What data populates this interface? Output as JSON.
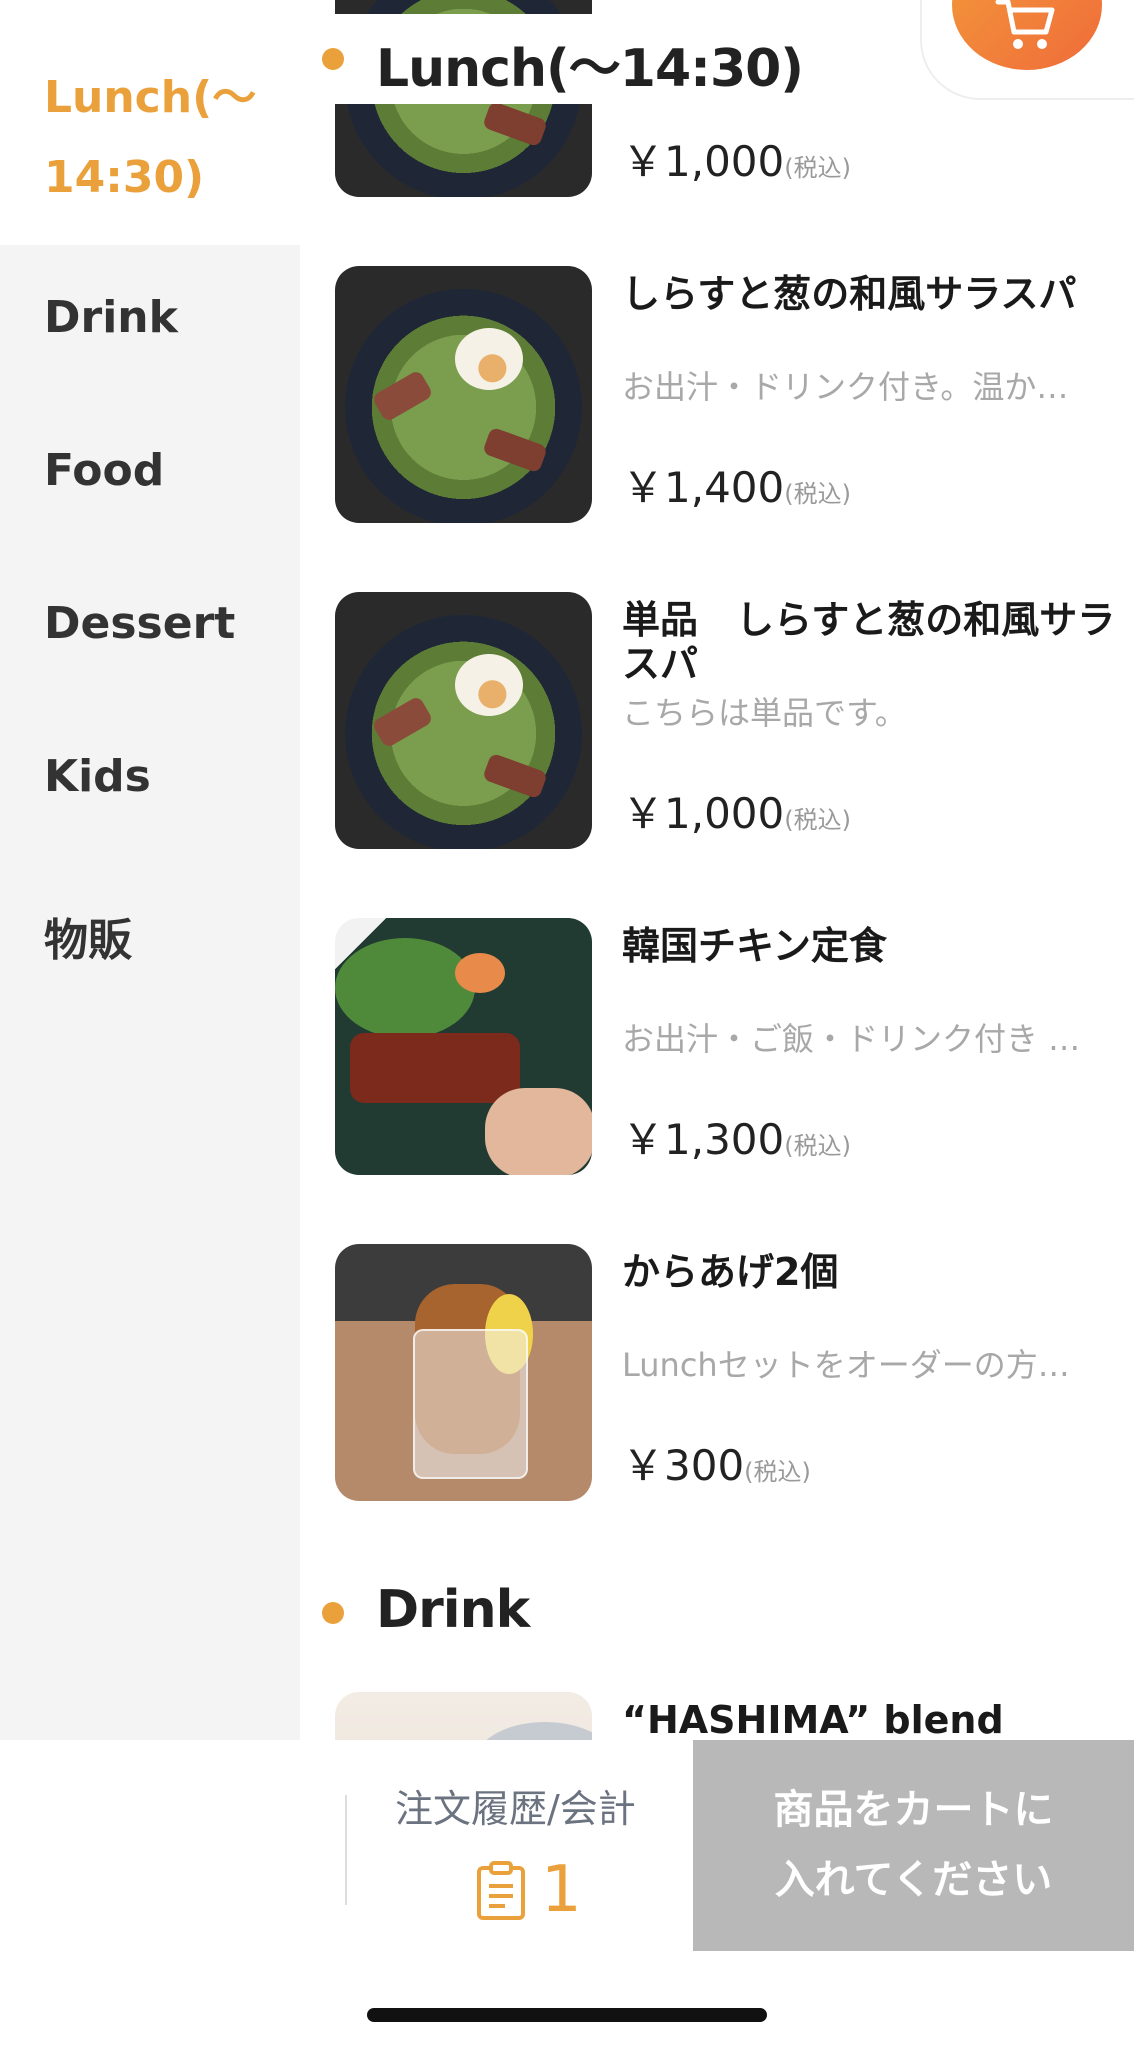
{
  "sidebar": {
    "active": "Lunch(〜14:30)",
    "items": [
      "Drink",
      "Food",
      "Dessert",
      "Kids",
      "物販"
    ]
  },
  "sections": [
    {
      "title": "Lunch(〜14:30)"
    },
    {
      "title": "Drink"
    }
  ],
  "menu_items": [
    {
      "name": "",
      "description": "",
      "price": "￥1,000",
      "tax": "(税込)"
    },
    {
      "name": "しらすと葱の和風サラスパ",
      "description": "お出汁・ドリンク付き。温か…",
      "price": "￥1,400",
      "tax": "(税込)"
    },
    {
      "name": "単品　しらすと葱の和風サラスパ",
      "description": "こちらは単品です。",
      "price": "￥1,000",
      "tax": "(税込)"
    },
    {
      "name": "韓国チキン定食",
      "description": "お出汁・ご飯・ドリンク付き …",
      "price": "￥1,300",
      "tax": "(税込)"
    },
    {
      "name": "からあげ2個",
      "description": "Lunchセットをオーダーの方…",
      "price": "￥300",
      "tax": "(税込)"
    },
    {
      "name": "“HASHIMA” blend"
    }
  ],
  "bottom_bar": {
    "history_label": "注文履歴/会計",
    "history_count": "1",
    "cta_line1": "商品をカートに",
    "cta_line2": "入れてください"
  },
  "icons": {
    "cart": "cart-icon",
    "clipboard": "clipboard-icon",
    "section_dot": "bullet-dot-icon"
  },
  "colors": {
    "accent": "#eba13b",
    "cart_gradient_start": "#f29a3a",
    "cart_gradient_end": "#f06b3a",
    "cta_disabled": "#b8b8b8",
    "sidebar_bg": "#f4f4f4"
  }
}
